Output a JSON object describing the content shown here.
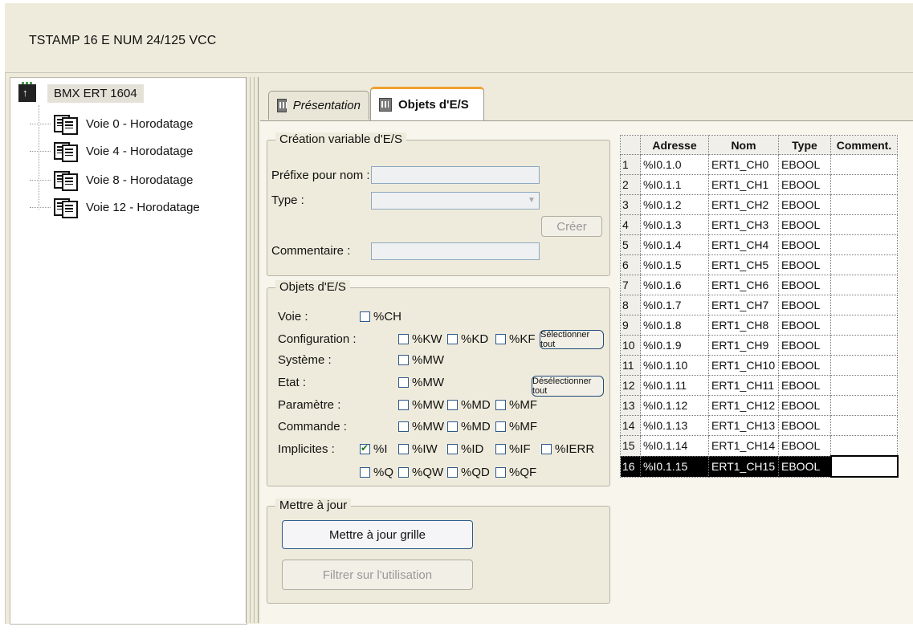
{
  "header": {
    "title": "TSTAMP 16 E NUM 24/125 VCC"
  },
  "tree": {
    "root": "BMX ERT 1604",
    "items": [
      "Voie 0 - Horodatage",
      "Voie 4 - Horodatage",
      "Voie 8 - Horodatage",
      "Voie 12 - Horodatage"
    ]
  },
  "tabs": [
    "Présentation",
    "Objets d'E/S"
  ],
  "creation": {
    "legend": "Création variable d'E/S",
    "prefix_label": "Préfixe pour nom :",
    "prefix_value": "",
    "type_label": "Type :",
    "type_value": "",
    "create_button": "Créer",
    "comment_label": "Commentaire :",
    "comment_value": ""
  },
  "objects": {
    "legend": "Objets d'E/S",
    "rows": [
      "Voie :",
      "Configuration :",
      "Système :",
      "Etat :",
      "Paramètre :",
      "Commande :",
      "Implicites :"
    ],
    "select_all": "Sélectionner tout",
    "deselect_all": "Désélectionner tout",
    "voie": [
      "%CH"
    ],
    "configuration": [
      "%KW",
      "%KD",
      "%KF"
    ],
    "systeme": [
      "%MW"
    ],
    "etat": [
      "%MW"
    ],
    "parametre": [
      "%MW",
      "%MD",
      "%MF"
    ],
    "commande": [
      "%MW",
      "%MD",
      "%MF"
    ],
    "implicites_1": [
      "%I",
      "%IW",
      "%ID",
      "%IF",
      "%IERR"
    ],
    "implicites_2": [
      "%Q",
      "%QW",
      "%QD",
      "%QF"
    ],
    "checked": [
      "%I"
    ]
  },
  "update": {
    "legend": "Mettre à jour",
    "update_button": "Mettre à jour grille",
    "filter_button": "Filtrer sur l'utilisation"
  },
  "grid": {
    "headers": [
      "Adresse",
      "Nom",
      "Type",
      "Comment."
    ],
    "rows": [
      [
        "1",
        "%I0.1.0",
        "ERT1_CH0",
        "EBOOL",
        ""
      ],
      [
        "2",
        "%I0.1.1",
        "ERT1_CH1",
        "EBOOL",
        ""
      ],
      [
        "3",
        "%I0.1.2",
        "ERT1_CH2",
        "EBOOL",
        ""
      ],
      [
        "4",
        "%I0.1.3",
        "ERT1_CH3",
        "EBOOL",
        ""
      ],
      [
        "5",
        "%I0.1.4",
        "ERT1_CH4",
        "EBOOL",
        ""
      ],
      [
        "6",
        "%I0.1.5",
        "ERT1_CH5",
        "EBOOL",
        ""
      ],
      [
        "7",
        "%I0.1.6",
        "ERT1_CH6",
        "EBOOL",
        ""
      ],
      [
        "8",
        "%I0.1.7",
        "ERT1_CH7",
        "EBOOL",
        ""
      ],
      [
        "9",
        "%I0.1.8",
        "ERT1_CH8",
        "EBOOL",
        ""
      ],
      [
        "10",
        "%I0.1.9",
        "ERT1_CH9",
        "EBOOL",
        ""
      ],
      [
        "11",
        "%I0.1.10",
        "ERT1_CH10",
        "EBOOL",
        ""
      ],
      [
        "12",
        "%I0.1.11",
        "ERT1_CH11",
        "EBOOL",
        ""
      ],
      [
        "13",
        "%I0.1.12",
        "ERT1_CH12",
        "EBOOL",
        ""
      ],
      [
        "14",
        "%I0.1.13",
        "ERT1_CH13",
        "EBOOL",
        ""
      ],
      [
        "15",
        "%I0.1.14",
        "ERT1_CH14",
        "EBOOL",
        ""
      ],
      [
        "16",
        "%I0.1.15",
        "ERT1_CH15",
        "EBOOL",
        ""
      ]
    ],
    "selected_row": 16
  }
}
